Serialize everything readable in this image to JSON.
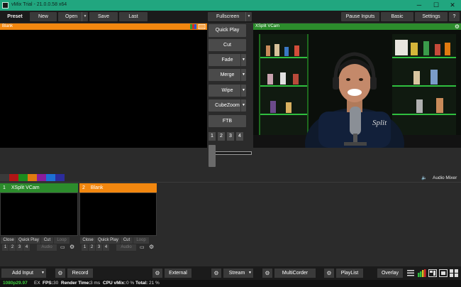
{
  "window": {
    "title": "vMix Trial - 21.0.0.58 x64",
    "controls": {
      "minimize": "─",
      "maximize": "☐",
      "close": "✕"
    }
  },
  "toolbar": {
    "preset": "Preset",
    "new": "New",
    "open": "Open",
    "save": "Save",
    "last": "Last",
    "fullscreen": "Fullscreen",
    "pause_inputs": "Pause Inputs",
    "basic": "Basic",
    "settings": "Settings",
    "help": "?"
  },
  "preview": {
    "label": "Blank",
    "header_color": "#f2870f"
  },
  "output": {
    "label": "XSplit VCam",
    "header_color": "#2c8c2c"
  },
  "transitions": {
    "quick_play": "Quick Play",
    "cut": "Cut",
    "fade": "Fade",
    "merge": "Merge",
    "wipe": "Wipe",
    "cube_zoom": "CubeZoom",
    "ftb": "FTB",
    "numbers": [
      "1",
      "2",
      "3",
      "4"
    ]
  },
  "color_tags": [
    "#3a3a3a",
    "#b01515",
    "#1d8c1d",
    "#e07a10",
    "#8a1d9c",
    "#1c6fd4",
    "#2c2c9c"
  ],
  "audio_mixer": "Audio Mixer",
  "inputs": [
    {
      "number": "1",
      "name": "XSplit VCam",
      "header_color": "#2c8c2c",
      "controls": [
        "Close",
        "Quick Play",
        "Cut",
        "Loop"
      ],
      "overlays": [
        "1",
        "2",
        "3",
        "4"
      ],
      "audio": "Audio"
    },
    {
      "number": "2",
      "name": "Blank",
      "header_color": "#f2870f",
      "controls": [
        "Close",
        "Quick Play",
        "Cut",
        "Loop"
      ],
      "overlays": [
        "1",
        "2",
        "3",
        "4"
      ],
      "audio": "Audio"
    }
  ],
  "bottom": {
    "add_input": "Add Input",
    "record": "Record",
    "external": "External",
    "stream": "Stream",
    "multicorder": "MultiCorder",
    "playlist": "PlayList",
    "overlay": "Overlay"
  },
  "status": {
    "resolution": "1080p29.97",
    "ex": "EX",
    "fps_label": "FPS:",
    "fps": "30",
    "render_label": "Render Time:",
    "render": "3 ms",
    "cpu_label": "CPU vMix:",
    "cpu": "0 %",
    "total_label": "Total:",
    "total": "21 %"
  }
}
